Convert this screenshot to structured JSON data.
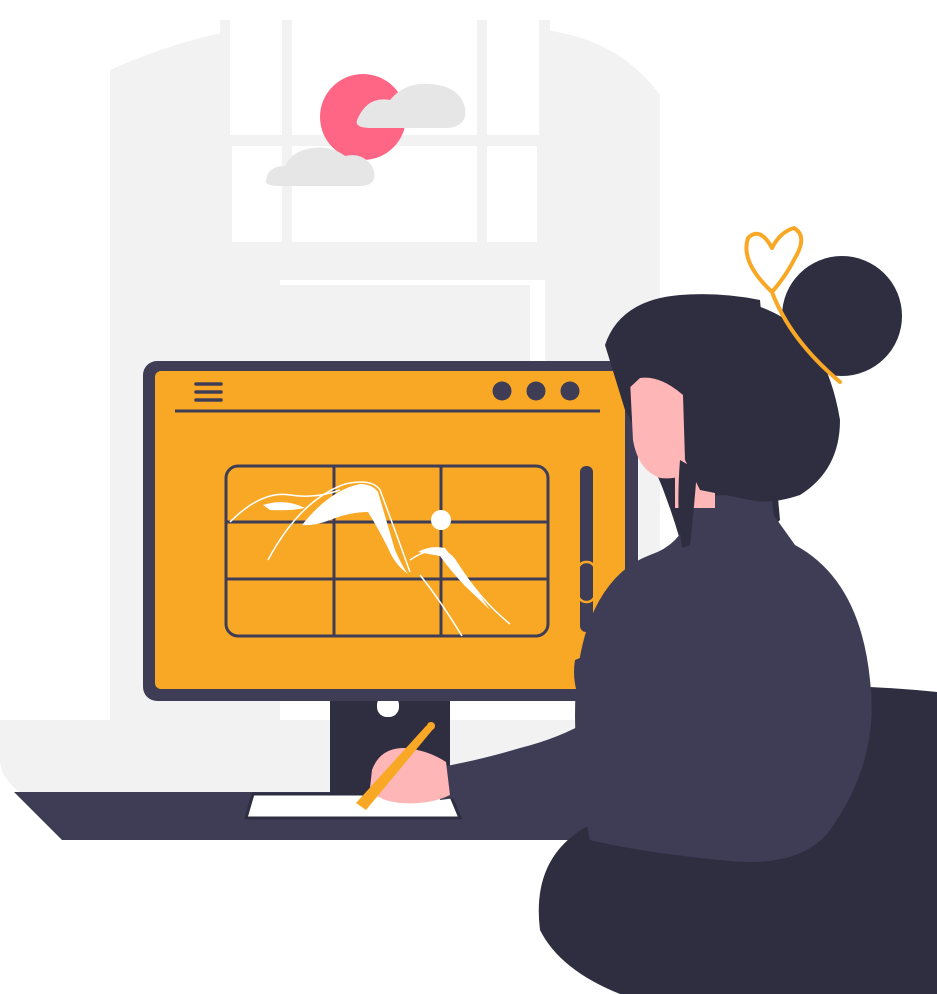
{
  "illustration": {
    "subject": "woman-drawing-at-computer",
    "icons": [
      "sun-icon",
      "cloud-icon",
      "hamburger-menu-icon",
      "window-dots-icon",
      "mountain-sketch-icon",
      "pen-icon",
      "bow-icon"
    ]
  },
  "colors": {
    "background": "#ffffff",
    "wall_window": "#f2f2f2",
    "sun": "#ff6584",
    "cloud": "#e6e6e6",
    "monitor_frame": "#3f3d56",
    "screen": "#f9a826",
    "dark": "#2f2e41",
    "sweater": "#3f3d56",
    "skin": "#ffb6b6",
    "hair": "#2f2e41",
    "bow": "#f9a826",
    "sketch_lines": "#ffffff"
  }
}
